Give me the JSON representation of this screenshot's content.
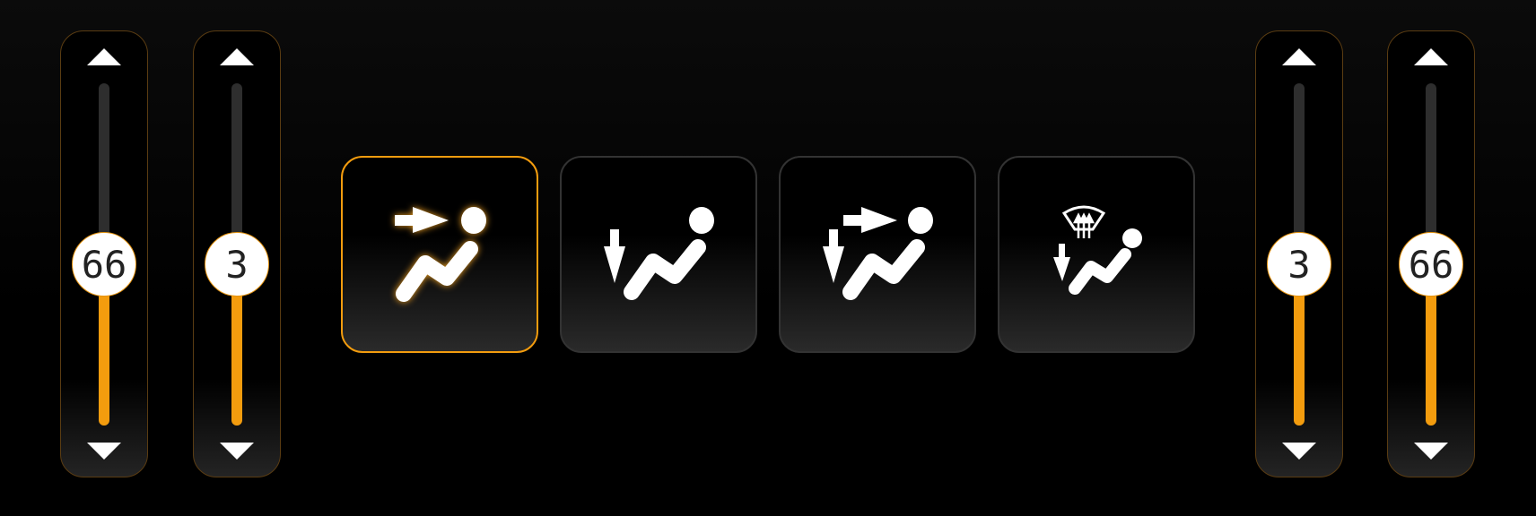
{
  "sliders": [
    {
      "id": "left-temp",
      "value": "66",
      "fraction": 0.47
    },
    {
      "id": "left-fan",
      "value": "3",
      "fraction": 0.47
    },
    {
      "id": "right-fan",
      "value": "3",
      "fraction": 0.47
    },
    {
      "id": "right-temp",
      "value": "66",
      "fraction": 0.47
    }
  ],
  "modes": [
    {
      "icon": "airflow-face-icon",
      "active": true
    },
    {
      "icon": "airflow-feet-icon",
      "active": false
    },
    {
      "icon": "airflow-face-feet-icon",
      "active": false
    },
    {
      "icon": "airflow-defrost-feet-icon",
      "active": false
    }
  ],
  "colors": {
    "accent": "#f39c0e",
    "track": "#2e2e2e"
  }
}
